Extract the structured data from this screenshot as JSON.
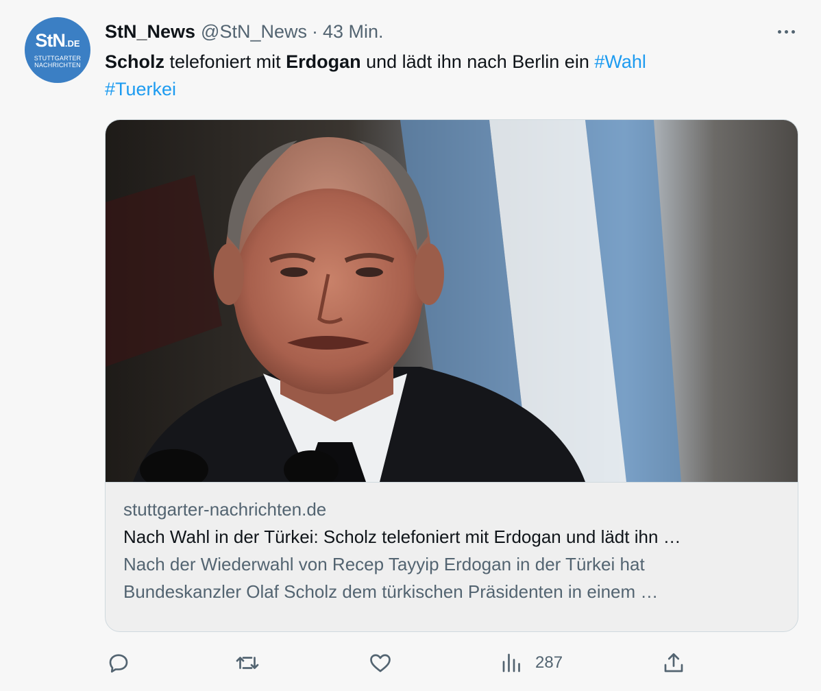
{
  "account": {
    "display_name": "StN_News",
    "handle": "@StN_News",
    "separator": "·",
    "time": "43 Min.",
    "avatar_logo": "StN",
    "avatar_logo_suffix": ".DE",
    "avatar_subtitle_1": "STUTTGARTER",
    "avatar_subtitle_2": "NACHRICHTEN"
  },
  "tweet": {
    "part1_bold": "Scholz",
    "part2": " telefoniert mit ",
    "part3_bold": "Erdogan",
    "part4": " und lädt ihn nach Berlin ein ",
    "hashtag1": "#Wahl",
    "hashtag2": "#Tuerkei"
  },
  "card": {
    "image_description": "photo-of-olaf-scholz",
    "domain": "stuttgarter-nachrichten.de",
    "title": "Nach Wahl in der Türkei: Scholz telefoniert mit Erdogan und lädt ihn …",
    "description_line1": "Nach der Wiederwahl von Recep Tayyip Erdogan in der Türkei hat",
    "description_line2": "Bundeskanzler Olaf Scholz dem türkischen Präsidenten in einem …"
  },
  "actions": {
    "reply_icon": "speech-bubble-icon",
    "retweet_icon": "retweet-arrows-icon",
    "like_icon": "heart-icon",
    "views_icon": "bar-chart-icon",
    "views_count": "287",
    "share_icon": "upload-arrow-icon"
  },
  "colors": {
    "background": "#f7f7f7",
    "accent": "#1d9bf0",
    "muted_text": "#536471",
    "avatar_blue": "#3b7fc4"
  }
}
